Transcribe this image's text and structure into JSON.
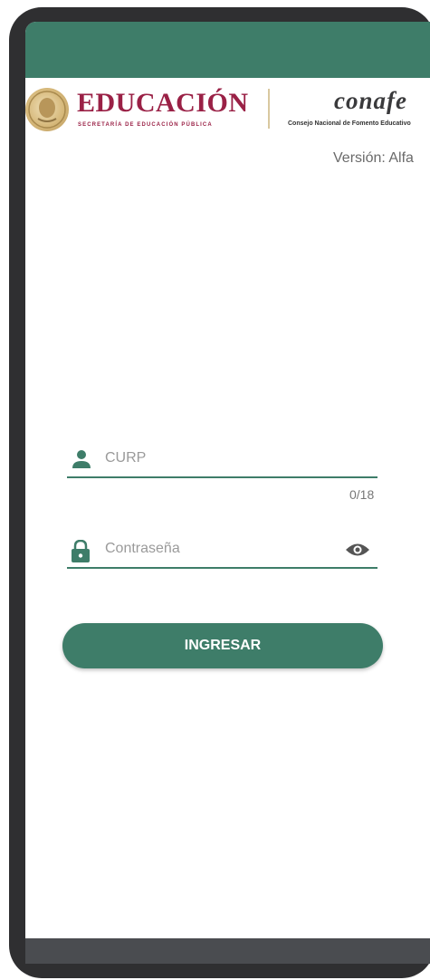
{
  "header": {
    "education_title": "EDUCACIÓN",
    "education_subtitle": "SECRETARÍA DE EDUCACIÓN PÚBLICA",
    "conafe_title": "conafe",
    "conafe_subtitle": "Consejo Nacional de Fomento Educativo"
  },
  "version": "Versión: Alfa",
  "form": {
    "curp_placeholder": "CURP",
    "curp_counter": "0/18",
    "password_placeholder": "Contraseña",
    "submit_label": "INGRESAR"
  },
  "icons": {
    "curp": "person-icon",
    "password": "lock-icon",
    "toggle": "eye-icon"
  },
  "colors": {
    "accent": "#3e7d69",
    "brand_education": "#9a2146",
    "status_bar": "#3e7d69",
    "nav_bar": "#4a4c50"
  }
}
